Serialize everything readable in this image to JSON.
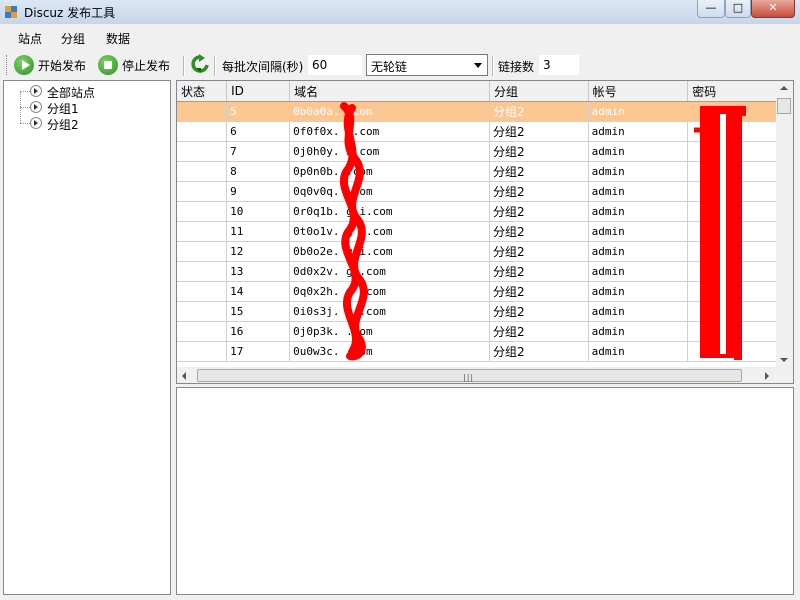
{
  "window": {
    "title": "Discuz 发布工具",
    "minimize_glyph": "—",
    "maximize_glyph": "□",
    "close_glyph": "✕"
  },
  "menu": {
    "items": [
      "站点",
      "分组",
      "数据"
    ]
  },
  "toolbar": {
    "start_label": "开始发布",
    "stop_label": "停止发布",
    "interval_label": "每批次间隔(秒)",
    "interval_value": "60",
    "chain_selected": "无轮链",
    "link_count_label": "链接数",
    "link_count_value": "3"
  },
  "tree": {
    "root": "全部站点",
    "children": [
      "分组1",
      "分组2"
    ]
  },
  "grid": {
    "columns": [
      "状态",
      "ID",
      "域名",
      "分组",
      "帐号",
      "密码"
    ],
    "rows": [
      {
        "status": "",
        "id": "5",
        "domain": "0b0a0a.      .com",
        "group": "分组2",
        "account": "admin",
        "password": "",
        "selected": true
      },
      {
        "status": "",
        "id": "6",
        "domain": "0f0f0x.      i.com",
        "group": "分组2",
        "account": "admin",
        "password": ""
      },
      {
        "status": "",
        "id": "7",
        "domain": "0j0h0y.      i.com",
        "group": "分组2",
        "account": "admin",
        "password": ""
      },
      {
        "status": "",
        "id": "8",
        "domain": "0p0n0b.      .com",
        "group": "分组2",
        "account": "admin",
        "password": ""
      },
      {
        "status": "",
        "id": "9",
        "domain": "0q0v0q.      .com",
        "group": "分组2",
        "account": "admin",
        "password": ""
      },
      {
        "status": "",
        "id": "10",
        "domain": "0r0q1b. g    i.com",
        "group": "分组2",
        "account": "admin",
        "password": ""
      },
      {
        "status": "",
        "id": "11",
        "domain": "0t0o1v. g    i.com",
        "group": "分组2",
        "account": "admin",
        "password": ""
      },
      {
        "status": "",
        "id": "12",
        "domain": "0b0o2e. g    i.com",
        "group": "分组2",
        "account": "admin",
        "password": ""
      },
      {
        "status": "",
        "id": "13",
        "domain": "0d0x2v. g    .com",
        "group": "分组2",
        "account": "admin",
        "password": ""
      },
      {
        "status": "",
        "id": "14",
        "domain": "0q0x2h. g    .com",
        "group": "分组2",
        "account": "admin",
        "password": ""
      },
      {
        "status": "",
        "id": "15",
        "domain": "0i0s3j. g    .com",
        "group": "分组2",
        "account": "admin",
        "password": ""
      },
      {
        "status": "",
        "id": "16",
        "domain": "0j0p3k.      .com",
        "group": "分组2",
        "account": "admin",
        "password": ""
      },
      {
        "status": "",
        "id": "17",
        "domain": "0u0w3c.      .com",
        "group": "分组2",
        "account": "admin",
        "password": ""
      }
    ],
    "hscroll_grip": "|||"
  },
  "colors": {
    "selected_row": "#fbc691",
    "redaction": "#ff0000"
  }
}
